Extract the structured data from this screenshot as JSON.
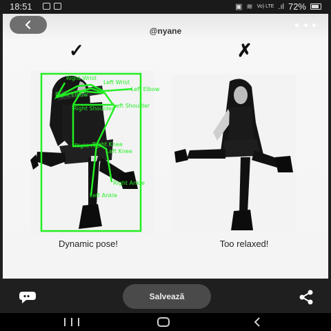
{
  "status_bar": {
    "time": "18:51",
    "network_label": "Vo) LTE",
    "battery": "72%"
  },
  "post": {
    "handle": "@nyane",
    "left_caption": "Dynamic pose!",
    "right_caption": "Too relaxed!",
    "left_mark": "✓",
    "right_mark": "✗"
  },
  "pose_overlay": {
    "color": "#22ee22",
    "keypoint_labels": [
      "Right Wrist",
      "Left Wrist",
      "Left Elbow",
      "Right Elbow",
      "Right Shoulder",
      "Left Shoulder",
      "Right Knee",
      "Right Hip",
      "Left Knee",
      "Right Ankle",
      "Left Ankle"
    ]
  },
  "bottom_bar": {
    "save_label": "Salvează"
  },
  "icons": {
    "back": "back-arrow-icon",
    "more": "more-dots-icon",
    "comment": "comment-icon",
    "share": "share-icon"
  }
}
